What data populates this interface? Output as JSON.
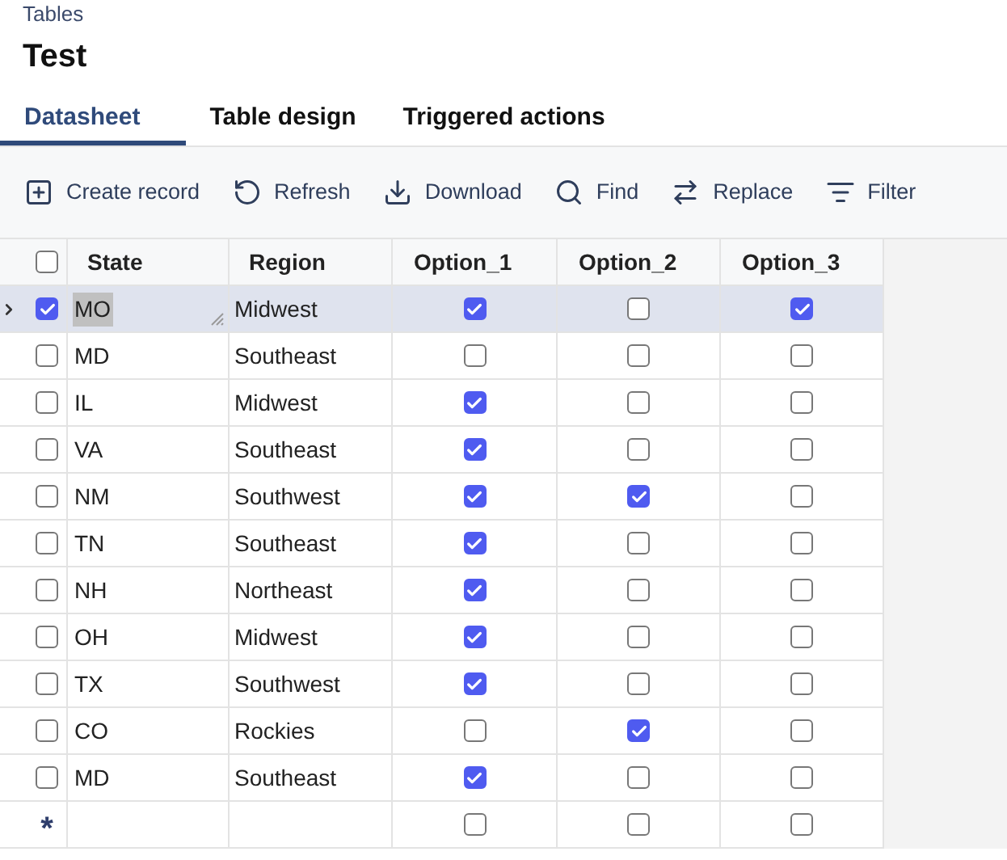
{
  "breadcrumb": "Tables",
  "title": "Test",
  "tabs": [
    {
      "label": "Datasheet",
      "selected": true
    },
    {
      "label": "Table design",
      "selected": false
    },
    {
      "label": "Triggered actions",
      "selected": false
    }
  ],
  "toolbar": [
    "Create record",
    "Refresh",
    "Download",
    "Find",
    "Replace",
    "Filter"
  ],
  "table": {
    "header_checked": false,
    "columns": [
      "State",
      "Region",
      "Option_1",
      "Option_2",
      "Option_3"
    ],
    "rows": [
      {
        "selected": true,
        "checked": true,
        "state": "MO",
        "region": "Midwest",
        "options": [
          true,
          false,
          true
        ]
      },
      {
        "selected": false,
        "checked": false,
        "state": "MD",
        "region": "Southeast",
        "options": [
          false,
          false,
          false
        ]
      },
      {
        "selected": false,
        "checked": false,
        "state": "IL",
        "region": "Midwest",
        "options": [
          true,
          false,
          false
        ]
      },
      {
        "selected": false,
        "checked": false,
        "state": "VA",
        "region": "Southeast",
        "options": [
          true,
          false,
          false
        ]
      },
      {
        "selected": false,
        "checked": false,
        "state": "NM",
        "region": "Southwest",
        "options": [
          true,
          true,
          false
        ]
      },
      {
        "selected": false,
        "checked": false,
        "state": "TN",
        "region": "Southeast",
        "options": [
          true,
          false,
          false
        ]
      },
      {
        "selected": false,
        "checked": false,
        "state": "NH",
        "region": "Northeast",
        "options": [
          true,
          false,
          false
        ]
      },
      {
        "selected": false,
        "checked": false,
        "state": "OH",
        "region": "Midwest",
        "options": [
          true,
          false,
          false
        ]
      },
      {
        "selected": false,
        "checked": false,
        "state": "TX",
        "region": "Southwest",
        "options": [
          true,
          false,
          false
        ]
      },
      {
        "selected": false,
        "checked": false,
        "state": "CO",
        "region": "Rockies",
        "options": [
          false,
          true,
          false
        ]
      },
      {
        "selected": false,
        "checked": false,
        "state": "MD",
        "region": "Southeast",
        "options": [
          true,
          false,
          false
        ]
      }
    ],
    "new_row": {
      "marker": "*",
      "options": [
        false,
        false,
        false
      ]
    }
  }
}
